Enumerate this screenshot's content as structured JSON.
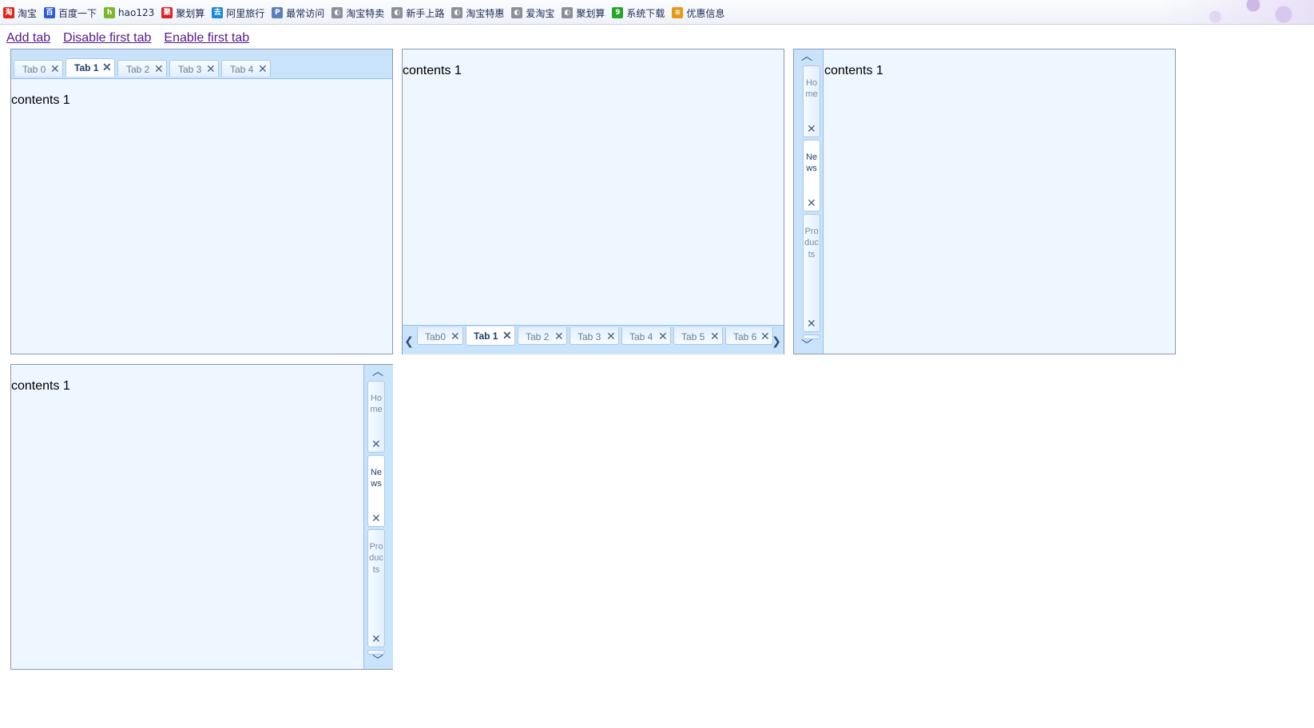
{
  "bookmarks": [
    {
      "label": "淘宝",
      "icon": "taobao-icon",
      "color": "#e2231a",
      "glyph": "淘"
    },
    {
      "label": "百度一下",
      "icon": "baidu-icon",
      "color": "#2f5cd6",
      "glyph": "百"
    },
    {
      "label": "hao123",
      "icon": "hao123-icon",
      "color": "#7bb72b",
      "glyph": "h"
    },
    {
      "label": "聚划算",
      "icon": "juhuasuan-icon",
      "color": "#d8232a",
      "glyph": "聚"
    },
    {
      "label": "阿里旅行",
      "icon": "alitrip-icon",
      "color": "#1a8ad8",
      "glyph": "去"
    },
    {
      "label": "最常访问",
      "icon": "mostvisited-icon",
      "color": "#5a7fbf",
      "glyph": "P"
    },
    {
      "label": "淘宝特卖",
      "icon": "globe-icon",
      "color": "#8a8f98",
      "glyph": "◐"
    },
    {
      "label": "新手上路",
      "icon": "globe-icon",
      "color": "#8a8f98",
      "glyph": "◐"
    },
    {
      "label": "淘宝特惠",
      "icon": "globe-icon",
      "color": "#8a8f98",
      "glyph": "◐"
    },
    {
      "label": "爱淘宝",
      "icon": "globe-icon",
      "color": "#8a8f98",
      "glyph": "◐"
    },
    {
      "label": "聚划算",
      "icon": "globe-icon",
      "color": "#8a8f98",
      "glyph": "◐"
    },
    {
      "label": "系统下载",
      "icon": "download-9-icon",
      "color": "#27a52a",
      "glyph": "9"
    },
    {
      "label": "优惠信息",
      "icon": "rss-icon",
      "color": "#e39a16",
      "glyph": "≋"
    }
  ],
  "links": {
    "add": "Add tab",
    "disable": "Disable first tab",
    "enable": "Enable first tab"
  },
  "close_glyph": "✕",
  "chevrons": {
    "left": "❮",
    "right": "❯",
    "up": "︿",
    "down": "﹀"
  },
  "panel_top": {
    "tabs": [
      "Tab 0",
      "Tab 1",
      "Tab 2",
      "Tab 3",
      "Tab 4"
    ],
    "active": 1,
    "content": "contents 1"
  },
  "panel_bottom": {
    "tabs": [
      "Tab0",
      "Tab 1",
      "Tab 2",
      "Tab 3",
      "Tab 4",
      "Tab 5",
      "Tab 6"
    ],
    "active": 1,
    "content": "contents 1"
  },
  "panel_left": {
    "tabs": [
      "Home",
      "News",
      "Products"
    ],
    "active": 1,
    "content": "contents 1"
  },
  "panel_right": {
    "tabs": [
      "Home",
      "News",
      "Products"
    ],
    "active": 1,
    "content": "contents 1"
  }
}
